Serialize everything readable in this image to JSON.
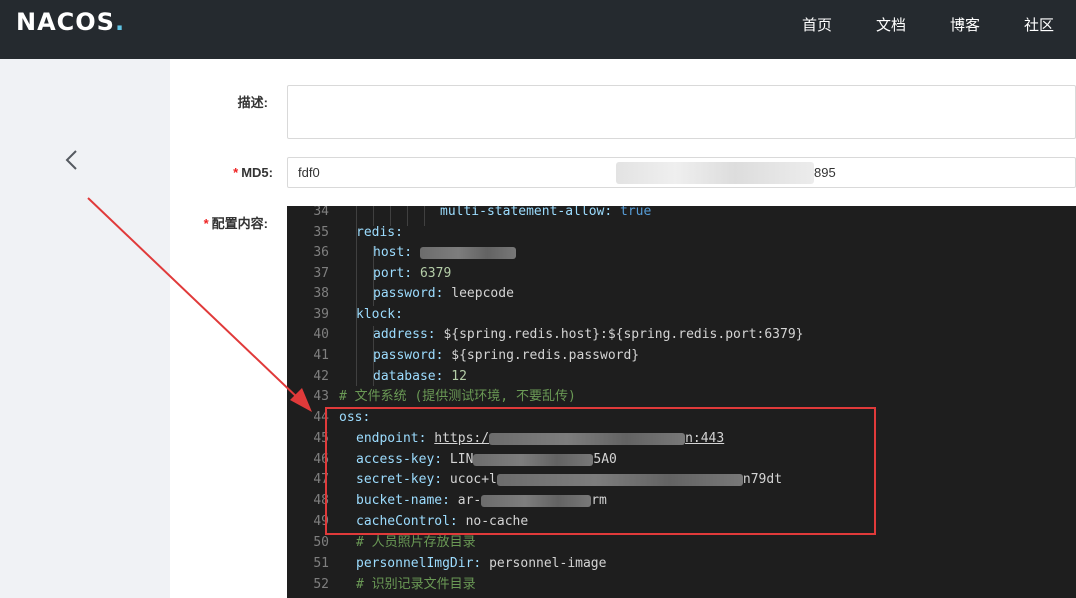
{
  "header": {
    "logo_main": "NACOS",
    "logo_dot": ".",
    "nav": [
      "首页",
      "文档",
      "博客",
      "社区"
    ]
  },
  "form": {
    "desc_label": "描述:",
    "md5_required": "*",
    "md5_label": "MD5:",
    "md5_value_start": "fdf0",
    "md5_value_end": "895",
    "content_required": "*",
    "content_label": "配置内容:"
  },
  "editor": {
    "lines": [
      {
        "n": "34",
        "key": "multi-statement-allow: ",
        "val": "true"
      },
      {
        "n": "35",
        "key": "redis:"
      },
      {
        "n": "36",
        "key": "host: "
      },
      {
        "n": "37",
        "key": "port: ",
        "val": "6379"
      },
      {
        "n": "38",
        "key": "password: ",
        "val": "leepcode"
      },
      {
        "n": "39",
        "key": "klock:"
      },
      {
        "n": "40",
        "key": "address: ",
        "val": "${spring.redis.host}:${spring.redis.port:6379}"
      },
      {
        "n": "41",
        "key": "password: ",
        "val": "${spring.redis.password}"
      },
      {
        "n": "42",
        "key": "database: ",
        "val": "12"
      },
      {
        "n": "43",
        "comment": "# 文件系统 (提供测试环境, 不要乱传)"
      },
      {
        "n": "44",
        "key": "oss:"
      },
      {
        "n": "45",
        "key": "endpoint: ",
        "val_a": "https:/",
        "val_b": "n:443"
      },
      {
        "n": "46",
        "key": "access-key: ",
        "val_a": "LIN",
        "val_b": "5A0"
      },
      {
        "n": "47",
        "key": "secret-key: ",
        "val_a": "ucoc+l",
        "val_b": "n79dt"
      },
      {
        "n": "48",
        "key": "bucket-name: ",
        "val_a": "ar-",
        "val_b": "rm"
      },
      {
        "n": "49",
        "key": "cacheControl: ",
        "val": "no-cache"
      },
      {
        "n": "50",
        "comment": "# 人员照片存放目录"
      },
      {
        "n": "51",
        "key": "personnelImgDir: ",
        "val": "personnel-image"
      },
      {
        "n": "52",
        "comment": "# 识别记录文件目录"
      }
    ]
  },
  "colors": {
    "topbar": "#252a2f",
    "annotation": "#e03a3a",
    "editor_bg": "#1e1e1e"
  }
}
